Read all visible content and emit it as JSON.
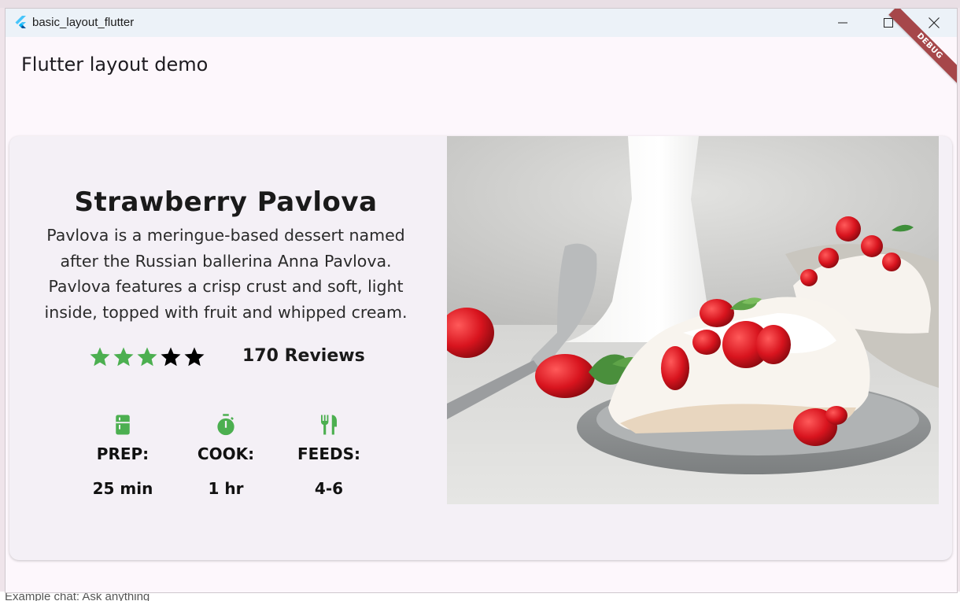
{
  "background": {
    "bottom_text": "Example chat: Ask anything",
    "bottom_text_right": "",
    "colors": {
      "desktop": "#efe4ea"
    }
  },
  "window": {
    "title": "basic_layout_flutter",
    "icons": {
      "app": "flutter-logo-icon",
      "minimize": "minimize-icon",
      "maximize": "maximize-icon",
      "close": "close-icon"
    }
  },
  "debug_banner": "DEBUG",
  "appbar": {
    "title": "Flutter layout demo"
  },
  "recipe": {
    "title": "Strawberry Pavlova",
    "description": "Pavlova is a meringue-based dessert named after the Russian ballerina Anna Pavlova. Pavlova features a crisp crust and soft, light inside, topped with fruit and whipped cream.",
    "rating": {
      "filled_stars": 3,
      "total_stars": 5,
      "reviews": "170 Reviews"
    },
    "stats": [
      {
        "icon": "kitchen-icon",
        "label": "PREP:",
        "value": "25 min"
      },
      {
        "icon": "timer-icon",
        "label": "COOK:",
        "value": "1 hr"
      },
      {
        "icon": "restaurant-icon",
        "label": "FEEDS:",
        "value": "4-6"
      }
    ],
    "image": "pavlova-photo"
  },
  "colors": {
    "accent_green": "#4caf50",
    "star_filled": "#4caf50",
    "star_empty": "#000000",
    "card_bg": "#f4f0f6",
    "debug_banner": "#a6474a"
  }
}
